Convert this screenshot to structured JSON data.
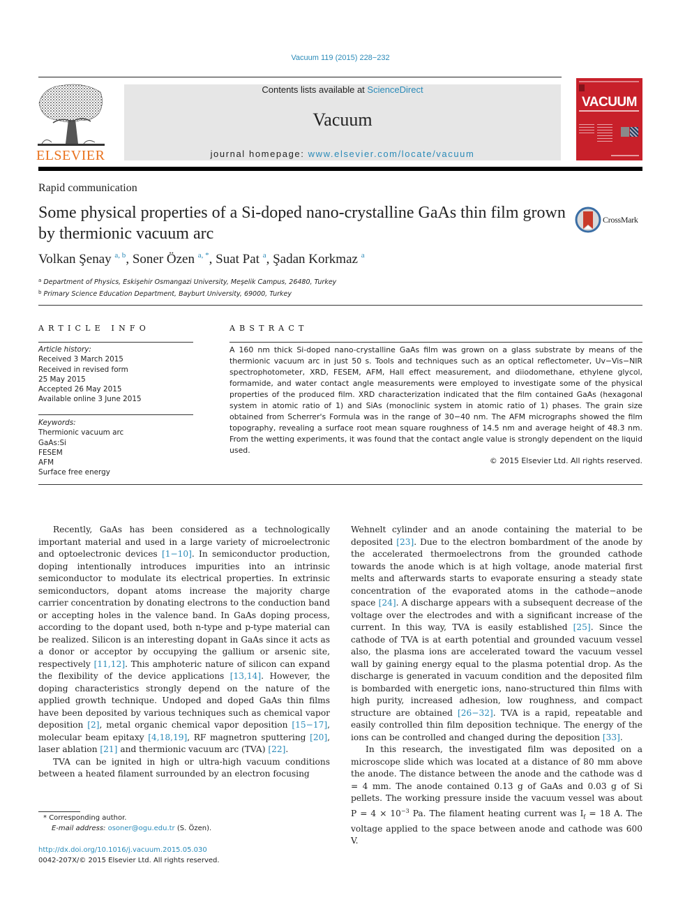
{
  "header": {
    "citation": "Vacuum 119 (2015) 228−232",
    "contents_prefix": "Contents lists available at ",
    "contents_link": "ScienceDirect",
    "journal_name": "Vacuum",
    "homepage_prefix": "journal homepage: ",
    "homepage_link": "www.elsevier.com/locate/vacuum",
    "publisher_logo_text": "ELSEVIER",
    "cover_title": "VACUUM",
    "crossmark_label": "CrossMark",
    "colors": {
      "link": "#2a8ab8",
      "elsevier_orange": "#e9711c",
      "cover_red": "#c8202a",
      "header_box": "#e6e6e6"
    }
  },
  "article": {
    "type": "Rapid communication",
    "title": "Some physical properties of a Si-doped nano-crystalline GaAs thin film grown by thermionic vacuum arc",
    "authors": [
      {
        "name": "Volkan Şenay",
        "sup": "a, b",
        "sep": ", "
      },
      {
        "name": "Soner Özen",
        "sup": "a, *",
        "sep": ", "
      },
      {
        "name": "Suat Pat",
        "sup": "a",
        "sep": ", "
      },
      {
        "name": "Şadan Korkmaz",
        "sup": "a",
        "sep": ""
      }
    ],
    "affiliations": [
      {
        "key": "a",
        "text": "Department of Physics, Eskişehir Osmangazi University, Meşelik Campus, 26480, Turkey"
      },
      {
        "key": "b",
        "text": "Primary Science Education Department, Bayburt University, 69000, Turkey"
      }
    ]
  },
  "article_info": {
    "heading": "ARTICLE INFO",
    "history_label": "Article history:",
    "history": [
      "Received 3 March 2015",
      "Received in revised form",
      "25 May 2015",
      "Accepted 26 May 2015",
      "Available online 3 June 2015"
    ],
    "keywords_label": "Keywords:",
    "keywords": [
      "Thermionic vacuum arc",
      "GaAs:Si",
      "FESEM",
      "AFM",
      "Surface free energy"
    ]
  },
  "abstract": {
    "heading": "ABSTRACT",
    "text": "A 160 nm thick Si-doped nano-crystalline GaAs film was grown on a glass substrate by means of the thermionic vacuum arc in just 50 s. Tools and techniques such as an optical reflectometer, Uv−Vis−NIR spectrophotometer, XRD, FESEM, AFM, Hall effect measurement, and diiodomethane, ethylene glycol, formamide, and water contact angle measurements were employed to investigate some of the physical properties of the produced film. XRD characterization indicated that the film contained GaAs (hexagonal system in atomic ratio of 1) and SiAs (monoclinic system in atomic ratio of 1) phases. The grain size obtained from Scherrer's Formula was in the range of 30−40 nm. The AFM micrographs showed the film topography, revealing a surface root mean square roughness of 14.5 nm and average height of 48.3 nm. From the wetting experiments, it was found that the contact angle value is strongly dependent on the liquid used.",
    "copyright": "© 2015 Elsevier Ltd. All rights reserved."
  },
  "body": {
    "left": [
      [
        {
          "t": "Recently, GaAs has been considered as a technologically important material and used in a large variety of microelectronic and optoelectronic devices "
        },
        {
          "r": "[1−10]"
        },
        {
          "t": ". In semiconductor production, doping intentionally introduces impurities into an intrinsic semiconductor to modulate its electrical properties. In extrinsic semiconductors, dopant atoms increase the majority charge carrier concentration by donating electrons to the conduction band or accepting holes in the valence band. In GaAs doping process, according to the dopant used, both n-type and p-type material can be realized. Silicon is an interesting dopant in GaAs since it acts as a donor or acceptor by occupying the gallium or arsenic site, respectively "
        },
        {
          "r": "[11,12]"
        },
        {
          "t": ". This amphoteric nature of silicon can expand the flexibility of the device applications "
        },
        {
          "r": "[13,14]"
        },
        {
          "t": ". However, the doping characteristics strongly depend on the nature of the applied growth technique. Undoped and doped GaAs thin films have been deposited by various techniques such as chemical vapor deposition "
        },
        {
          "r": "[2]"
        },
        {
          "t": ", metal organic chemical vapor deposition "
        },
        {
          "r": "[15−17]"
        },
        {
          "t": ", molecular beam epitaxy "
        },
        {
          "r": "[4,18,19]"
        },
        {
          "t": ", RF magnetron sputtering "
        },
        {
          "r": "[20]"
        },
        {
          "t": ", laser ablation "
        },
        {
          "r": "[21]"
        },
        {
          "t": " and thermionic vacuum arc (TVA) "
        },
        {
          "r": "[22]"
        },
        {
          "t": "."
        }
      ],
      [
        {
          "t": "TVA can be ignited in high or ultra-high vacuum conditions between a heated filament surrounded by an electron focusing"
        }
      ]
    ],
    "right": [
      [
        {
          "t": "Wehnelt cylinder and an anode containing the material to be deposited "
        },
        {
          "r": "[23]"
        },
        {
          "t": ". Due to the electron bombardment of the anode by the accelerated thermoelectrons from the grounded cathode towards the anode which is at high voltage, anode material first melts and afterwards starts to evaporate ensuring a steady state concentration of the evaporated atoms in the cathode−anode space "
        },
        {
          "r": "[24]"
        },
        {
          "t": ". A discharge appears with a subsequent decrease of the voltage over the electrodes and with a significant increase of the current. In this way, TVA is easily established "
        },
        {
          "r": "[25]"
        },
        {
          "t": ". Since the cathode of TVA is at earth potential and grounded vacuum vessel also, the plasma ions are accelerated toward the vacuum vessel wall by gaining energy equal to the plasma potential drop. As the discharge is generated in vacuum condition and the deposited film is bombarded with energetic ions, nano-structured thin films with high purity, increased adhesion, low roughness, and compact structure are obtained "
        },
        {
          "r": "[26−32]"
        },
        {
          "t": ". TVA is a rapid, repeatable and easily controlled thin film deposition technique. The energy of the ions can be controlled and changed during the deposition "
        },
        {
          "r": "[33]"
        },
        {
          "t": "."
        }
      ],
      [
        {
          "t": "In this research, the investigated film was deposited on a microscope slide which was located at a distance of 80 mm above the anode. The distance between the anode and the cathode was d = 4 mm. The anode contained 0.13 g of GaAs and 0.03 g of Si pellets. The working pressure inside the vacuum vessel was about P = 4 × 10"
        },
        {
          "sup": "−3"
        },
        {
          "t": " Pa. The filament heating current was I"
        },
        {
          "sub": "f"
        },
        {
          "t": " = 18 A. The voltage applied to the space between anode and cathode was 600 V."
        }
      ]
    ]
  },
  "footnote": {
    "marker": "*",
    "corresponding": "Corresponding author.",
    "email_label": "E-mail address: ",
    "email": "osoner@ogu.edu.tr",
    "email_suffix": " (S. Özen)."
  },
  "doi": {
    "link": "http://dx.doi.org/10.1016/j.vacuum.2015.05.030",
    "rights": "0042-207X/© 2015 Elsevier Ltd. All rights reserved."
  }
}
